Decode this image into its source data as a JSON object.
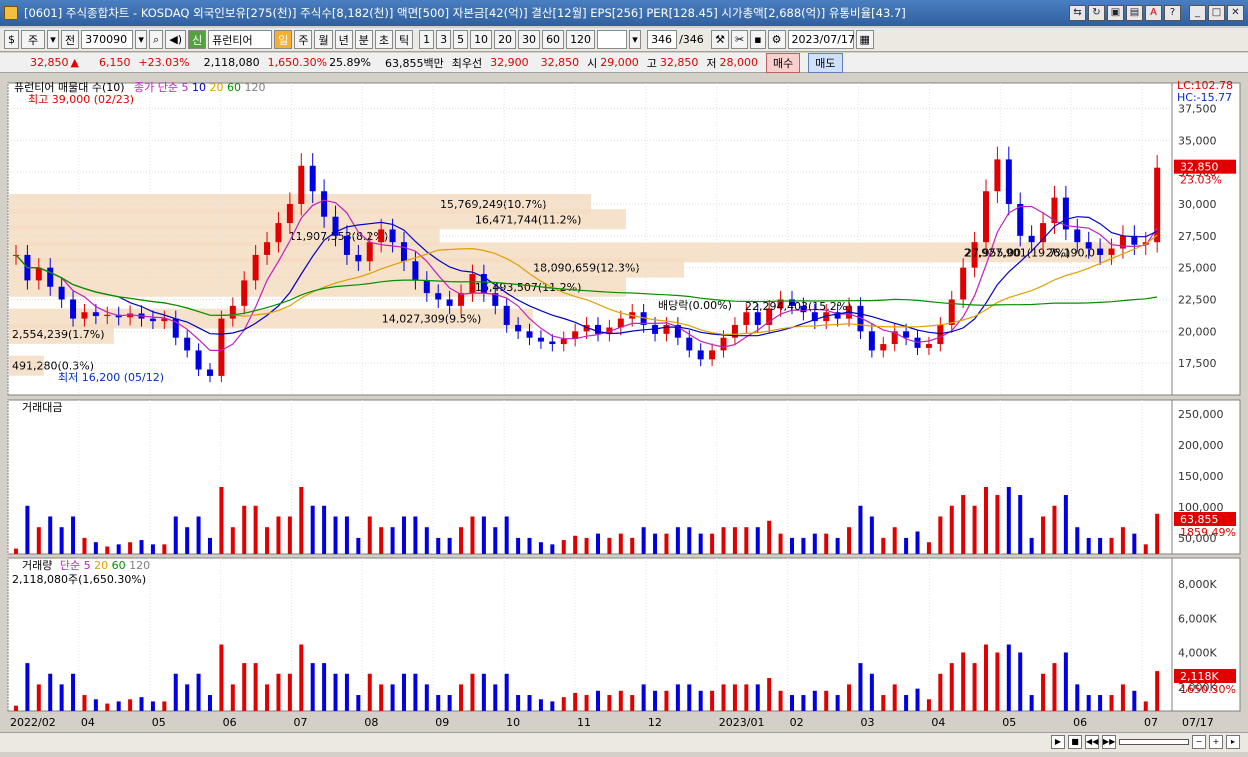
{
  "window": {
    "title": "[0601] 주식종합차트 - KOSDAQ 외국인보유[275(천)] 주식수[8,182(천)] 액면[500] 자본금[42(억)] 결산[12월] EPS[256] PER[128.45] 시가총액[2,688(억)] 유통비율[43.7]"
  },
  "toolbar": {
    "market": "주",
    "market_all": "전",
    "code": "370090",
    "name": "퓨런티어",
    "name_badge": "신",
    "periods": [
      "일",
      "주",
      "월",
      "년",
      "분",
      "초",
      "틱"
    ],
    "intervals": [
      "1",
      "3",
      "5",
      "10",
      "20",
      "30",
      "60",
      "120"
    ],
    "count": "346",
    "total": "/346",
    "date": "2023/07/17"
  },
  "quote": {
    "price": "32,850",
    "arrow": "▲",
    "change": "6,150",
    "pct": "+23.03%",
    "volume": "2,118,080",
    "vol_ratio": "1,650.30%",
    "turnover": "25.89%",
    "amount": "63,855백만",
    "best_label": "최우선",
    "best_ask": "32,900",
    "best_bid": "32,850",
    "open_label": "시",
    "open": "29,000",
    "high_label": "고",
    "high": "32,850",
    "low_label": "저",
    "low": "28,000",
    "buy": "매수",
    "sell": "매도"
  },
  "legend": {
    "price_title": "퓨런티어 매물대 수(10)",
    "ma_title": "종가 단순 5",
    "ma": [
      "10",
      "20",
      "60",
      "120"
    ],
    "amount_title": "거래대금",
    "vol_title": "거래량",
    "vol_ma_title": "단순 5",
    "vol_ma": [
      "20",
      "60",
      "120"
    ],
    "vol_today": "2,118,080주(1,650.30%)"
  },
  "annotations": {
    "high": "최고 39,000 (02/23)",
    "low": "최저 16,200 (05/12)",
    "dividend": "배당락(0.00%)",
    "lc": "LC:102.78",
    "hc": "HC:-15.77",
    "price_tag": "32,850",
    "price_pct": "23.03%",
    "amt_tag": "63,855",
    "amt_pct": "1859.49%",
    "vol_tag": "2,118K",
    "vol_pct": "1650.30%",
    "date_tag": "07/17"
  },
  "chart_data": {
    "type": "candlestick",
    "price_axis": {
      "ticks": [
        "37,500",
        "35,000",
        "32,500",
        "30,000",
        "27,500",
        "25,000",
        "22,500",
        "20,000",
        "17,500"
      ],
      "ylim": [
        15000,
        39500
      ]
    },
    "amount_axis": {
      "ticks": [
        "250,000",
        "200,000",
        "150,000",
        "100,000",
        "50,000"
      ]
    },
    "volume_axis": {
      "ticks": [
        "8,000K",
        "6,000K",
        "4,000K",
        "2,000K"
      ]
    },
    "x_labels": [
      "2022/02",
      "04",
      "05",
      "06",
      "07",
      "08",
      "09",
      "10",
      "11",
      "12",
      "2023/01",
      "02",
      "03",
      "04",
      "05",
      "06",
      "07"
    ],
    "volume_profile": [
      {
        "price": 30000,
        "label": "15,769,249(10.7%)",
        "width": 0.5
      },
      {
        "price": 28800,
        "label": "16,471,744(11.2%)",
        "width": 0.53
      },
      {
        "price": 27500,
        "label": "11,907,553(8.2%)",
        "width": 0.37
      },
      {
        "price": 26200,
        "label": "28,927,901(19.7%)",
        "width": 0.95
      },
      {
        "price": 25000,
        "label": "18,090,659(12.3%)",
        "width": 0.58
      },
      {
        "price": 23500,
        "label": "16,493,507(11.2%)",
        "width": 0.53
      },
      {
        "price": 21000,
        "label": "14,027,309(9.5%)",
        "width": 0.45
      },
      {
        "price": 19800,
        "label": "2,554,239(1.7%)",
        "width": 0.09
      },
      {
        "price": 17300,
        "label": "491,280(0.3%)",
        "width": 0.03
      }
    ],
    "extra_labels": [
      {
        "text": "27,955,00",
        "price": 26200
      },
      {
        "text": "26,190,0",
        "price": 26200
      },
      {
        "text": "22,294,403(15.2%)",
        "price": 22000
      }
    ],
    "closes": [
      26000,
      24000,
      25000,
      23500,
      22500,
      21000,
      21500,
      21200,
      21300,
      21100,
      21400,
      21000,
      20800,
      21000,
      19500,
      18500,
      17000,
      16500,
      21000,
      22000,
      24000,
      26000,
      27000,
      28500,
      30000,
      33000,
      31000,
      29000,
      27500,
      26000,
      25500,
      27000,
      28000,
      27000,
      25500,
      24000,
      23000,
      22500,
      22000,
      23000,
      24500,
      23000,
      22000,
      20500,
      20000,
      19500,
      19200,
      19000,
      19400,
      20000,
      20500,
      19800,
      20300,
      21000,
      21500,
      20500,
      19800,
      20500,
      19500,
      18500,
      17800,
      18500,
      19500,
      20500,
      21500,
      20500,
      21800,
      22500,
      22000,
      21500,
      20800,
      21500,
      21000,
      22000,
      20000,
      18500,
      19000,
      20000,
      19500,
      18700,
      19000,
      20500,
      22500,
      25000,
      27000,
      31000,
      33500,
      30000,
      27500,
      27000,
      28500,
      30500,
      28000,
      27000,
      26500,
      26000,
      26500,
      27500,
      26800,
      27000,
      32850
    ]
  }
}
